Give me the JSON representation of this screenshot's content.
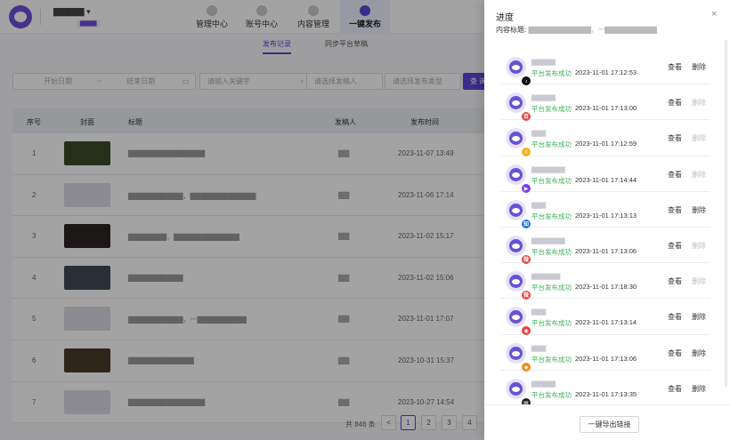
{
  "app": {
    "nav": [
      "管理中心",
      "账号中心",
      "内容管理",
      "一键发布"
    ],
    "active_nav": "一键发布",
    "subtabs": [
      "发布记录",
      "同步平台草稿"
    ],
    "filters": {
      "start_date": "开始日期",
      "range_sep": "~",
      "end_date": "结束日期",
      "keyword": "请输入关键字",
      "creator": "请选择发稿人",
      "type": "请选择发布类型",
      "query": "查 询"
    },
    "table": {
      "headers": [
        "序号",
        "封面",
        "标题",
        "发稿人",
        "发布时间"
      ],
      "rows": [
        {
          "no": "1",
          "time": "2023-11-07 13:49",
          "thumb": "#3a4a2a"
        },
        {
          "no": "2",
          "time": "2023-11-06 17:14",
          "thumb": "#d9d9e3"
        },
        {
          "no": "3",
          "time": "2023-11-02 15:17",
          "thumb": "#2d2724"
        },
        {
          "no": "4",
          "time": "2023-11-02 15:06",
          "thumb": "#3e4a56"
        },
        {
          "no": "5",
          "time": "2023-11-01 17:07",
          "thumb": "#d9d9e3"
        },
        {
          "no": "6",
          "time": "2023-10-31 15:37",
          "thumb": "#4a3b28"
        },
        {
          "no": "7",
          "time": "2023-10-27 14:54",
          "thumb": "#d9d9e3"
        }
      ]
    },
    "pager": {
      "total": "共 846 条",
      "prev": "<",
      "pages": [
        "1",
        "2",
        "3",
        "4"
      ],
      "active": "1"
    }
  },
  "drawer": {
    "title": "进度",
    "close": "×",
    "subtitle_label": "内容标题:",
    "subtitle_value": "▇▇▇▇▇▇▇▇▇▇▇▇，一▇▇▇▇▇▇▇▇▇▇",
    "view_label": "查看",
    "delete_label": "删除",
    "export_label": "一键导出链接",
    "items": [
      {
        "name": "▇▇▇▇▇",
        "status": "平台发布成功",
        "time": "2023-11-01 17:12:53",
        "badge": "♪",
        "badge_color": "#111111",
        "delete_enabled": true
      },
      {
        "name": "▇▇▇▇▇",
        "status": "平台发布成功",
        "time": "2023-11-01 17:13:00",
        "badge": "百",
        "badge_color": "#e8413b",
        "delete_enabled": false
      },
      {
        "name": "▇▇▇",
        "status": "平台发布成功",
        "time": "2023-11-01 17:12:59",
        "badge": "✕",
        "badge_color": "#f2b21b",
        "delete_enabled": false
      },
      {
        "name": "▇▇▇▇▇▇▇",
        "status": "平台发布成功",
        "time": "2023-11-01 17:14:44",
        "badge": "▶",
        "badge_color": "#7b3fe4",
        "delete_enabled": false
      },
      {
        "name": "▇▇▇",
        "status": "平台发布成功",
        "time": "2023-11-01 17:13:13",
        "badge": "知",
        "badge_color": "#1773ea",
        "delete_enabled": true
      },
      {
        "name": "▇▇▇▇▇▇▇",
        "status": "平台发布成功",
        "time": "2023-11-01 17:13:06",
        "badge": "微",
        "badge_color": "#e8413b",
        "delete_enabled": false
      },
      {
        "name": "▇▇▇▇▇▇",
        "status": "平台发布成功",
        "time": "2023-11-01 17:18:30",
        "badge": "微",
        "badge_color": "#e8413b",
        "delete_enabled": false
      },
      {
        "name": "▇▇▇",
        "status": "平台发布成功",
        "time": "2023-11-01 17:13:14",
        "badge": "◉",
        "badge_color": "#e8413b",
        "delete_enabled": true
      },
      {
        "name": "▇▇▇",
        "status": "平台发布成功",
        "time": "2023-11-01 17:13:06",
        "badge": "◆",
        "badge_color": "#f08a1a",
        "delete_enabled": true
      },
      {
        "name": "▇▇▇▇▇",
        "status": "平台发布成功",
        "time": "2023-11-01 17:13:35",
        "badge": "▤",
        "badge_color": "#222222",
        "delete_enabled": true
      }
    ]
  },
  "colors": {
    "accent": "#5b45d6",
    "success": "#3fb25b",
    "disabled": "#bfbfbf"
  }
}
